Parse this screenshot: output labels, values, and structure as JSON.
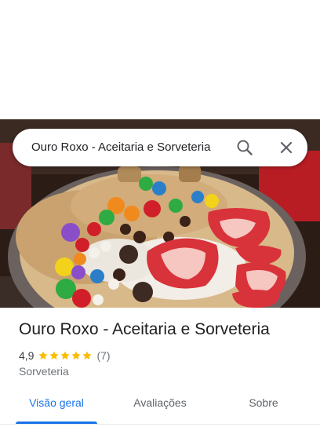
{
  "search": {
    "query": "Ouro Roxo - Aceitaria e Sorveteria",
    "search_icon": "search-icon",
    "close_icon": "close-icon"
  },
  "photo": {
    "icon": "place-photo"
  },
  "place": {
    "title": "Ouro Roxo - Aceitaria e Sorveteria",
    "rating": "4,9",
    "rating_stars": 5,
    "review_count": "(7)",
    "category": "Sorveteria"
  },
  "tabs": [
    {
      "label": "Visão geral",
      "active": true
    },
    {
      "label": "Avaliações",
      "active": false
    },
    {
      "label": "Sobre",
      "active": false
    }
  ],
  "colors": {
    "accent": "#1a73e8",
    "star": "#fbbc04",
    "text_primary": "#202124",
    "text_secondary": "#70757a"
  }
}
